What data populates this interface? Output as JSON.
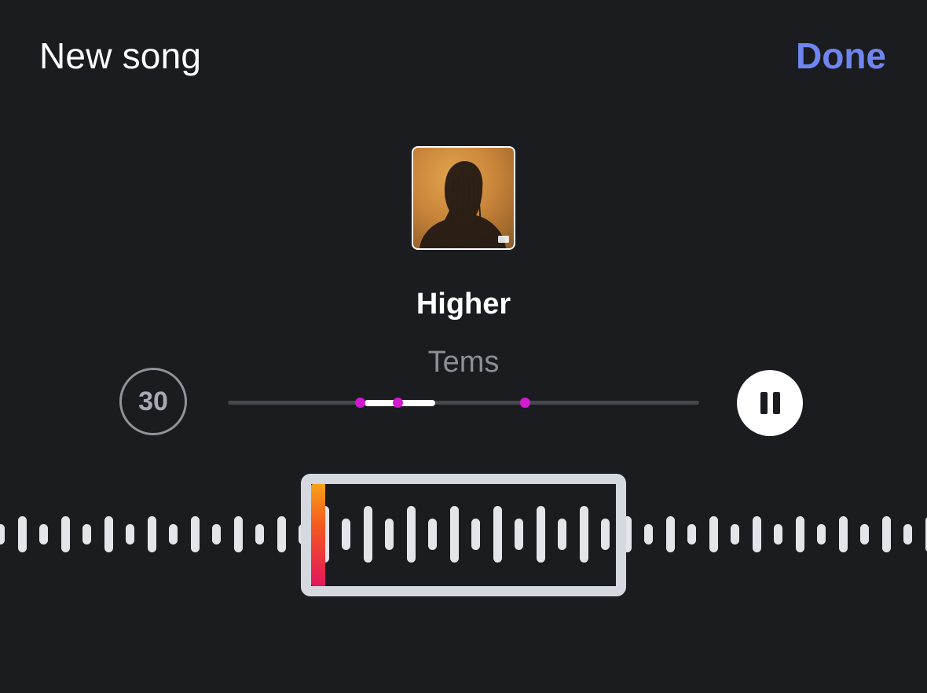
{
  "header": {
    "title": "New song",
    "done_label": "Done"
  },
  "song": {
    "title": "Higher",
    "artist": "Tems"
  },
  "controls": {
    "duration_label": "30",
    "playback_state": "playing"
  },
  "progress": {
    "segment_start": 0.29,
    "segment_end": 0.44,
    "markers": [
      0.28,
      0.36,
      0.63
    ]
  },
  "colors": {
    "background": "#1b1c20",
    "accent": "#6f86f0",
    "marker": "#d21ad2",
    "waveform": "#e4e5ea",
    "selection_frame": "#d5d8de"
  }
}
